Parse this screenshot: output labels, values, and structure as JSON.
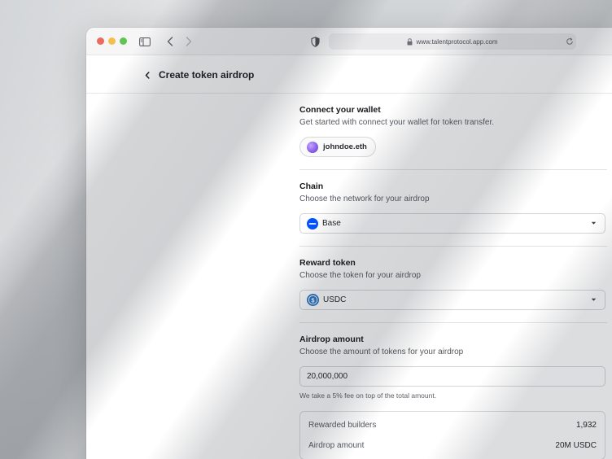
{
  "browser": {
    "url": "www.talentprotocol.app.com",
    "icons": [
      "sidebar-icon",
      "chevron-left-icon",
      "chevron-right-icon",
      "shield-icon",
      "lock-icon",
      "reload-icon"
    ]
  },
  "page": {
    "back_icon": "chevron-left-icon",
    "title": "Create token airdrop"
  },
  "wallet": {
    "title": "Connect your wallet",
    "description": "Get started with connect your wallet for token transfer.",
    "name": "johndoe.eth"
  },
  "chain": {
    "title": "Chain",
    "description": "Choose the network for your airdrop",
    "selected": "Base",
    "icon": "base-network-icon",
    "icon_color": "#0052ff"
  },
  "reward_token": {
    "title": "Reward token",
    "description": "Choose the token for your airdrop",
    "selected": "USDC",
    "icon": "usdc-icon",
    "icon_color": "#2775ca"
  },
  "airdrop_amount": {
    "title": "Airdrop amount",
    "description": "Choose the amount of tokens for your airdrop",
    "value": "20,000,000",
    "note": "We take a 5% fee on top of the total amount."
  },
  "summary": {
    "rows": [
      {
        "label": "Rewarded builders",
        "value": "1,932"
      },
      {
        "label": "Airdrop amount",
        "value": "20M USDC"
      }
    ]
  }
}
